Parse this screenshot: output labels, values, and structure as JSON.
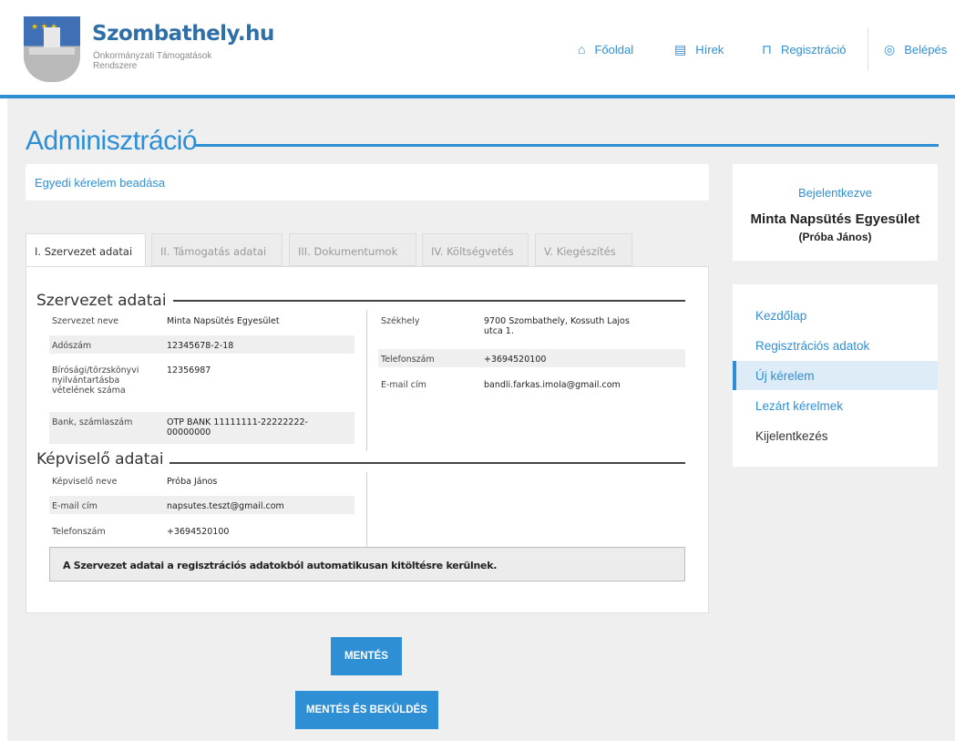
{
  "header": {
    "site_name": "Szombathely.hu",
    "site_sub": "Önkormányzati Támogatások Rendszere",
    "nav": [
      {
        "label": "Főoldal",
        "icon": "home-icon"
      },
      {
        "label": "Hírek",
        "icon": "news-icon"
      },
      {
        "label": "Regisztráció",
        "icon": "register-icon"
      },
      {
        "label": "Belépés",
        "icon": "user-icon"
      }
    ]
  },
  "page": {
    "title": "Adminisztráció",
    "subtitle": "Egyedi kérelem beadása"
  },
  "tabs": [
    {
      "label": "I. Szervezet adatai",
      "active": true
    },
    {
      "label": "II. Támogatás adatai",
      "active": false
    },
    {
      "label": "III. Dokumentumok",
      "active": false
    },
    {
      "label": "IV. Költségvetés",
      "active": false
    },
    {
      "label": "V. Kiegészítés",
      "active": false
    }
  ],
  "org": {
    "section_title": "Szervezet adatai",
    "left": [
      {
        "label": "Szervezet neve",
        "value": "Minta Napsütés Egyesület"
      },
      {
        "label": "Adószám",
        "value": "12345678-2-18"
      },
      {
        "label": "Bírósági/törzskönyvi nyilvántartásba vételének száma",
        "value": "12356987"
      },
      {
        "label": "Bank, számlaszám",
        "value": "OTP BANK 11111111-22222222-00000000"
      }
    ],
    "right": [
      {
        "label": "Székhely",
        "value": "9700 Szombathely, Kossuth Lajos utca 1."
      },
      {
        "label": "Telefonszám",
        "value": "+3694520100"
      },
      {
        "label": "E-mail cím",
        "value": "bandli.farkas.imola@gmail.com"
      }
    ]
  },
  "rep": {
    "section_title": "Képviselő adatai",
    "rows": [
      {
        "label": "Képviselő neve",
        "value": "Próba János"
      },
      {
        "label": "E-mail cím",
        "value": "napsutes.teszt@gmail.com"
      },
      {
        "label": "Telefonszám",
        "value": "+3694520100"
      }
    ]
  },
  "note": "A Szervezet adatai a regisztrációs adatokból automatikusan kitöltésre kerülnek.",
  "buttons": {
    "save": "MENTÉS",
    "save_send": "MENTÉS ÉS BEKÜLDÉS"
  },
  "sidebar": {
    "logged_in_label": "Bejelentkezve",
    "org_name": "Minta Napsütés Egyesület",
    "user_name": "(Próba János)",
    "menu": [
      {
        "label": "Kezdőlap",
        "active": false
      },
      {
        "label": "Regisztrációs adatok",
        "active": false
      },
      {
        "label": "Új kérelem",
        "active": true
      },
      {
        "label": "Lezárt kérelmek",
        "active": false
      },
      {
        "label": "Kijelentkezés",
        "active": false
      }
    ]
  },
  "colors": {
    "accent": "#2f8fd5",
    "background": "#efefef"
  }
}
